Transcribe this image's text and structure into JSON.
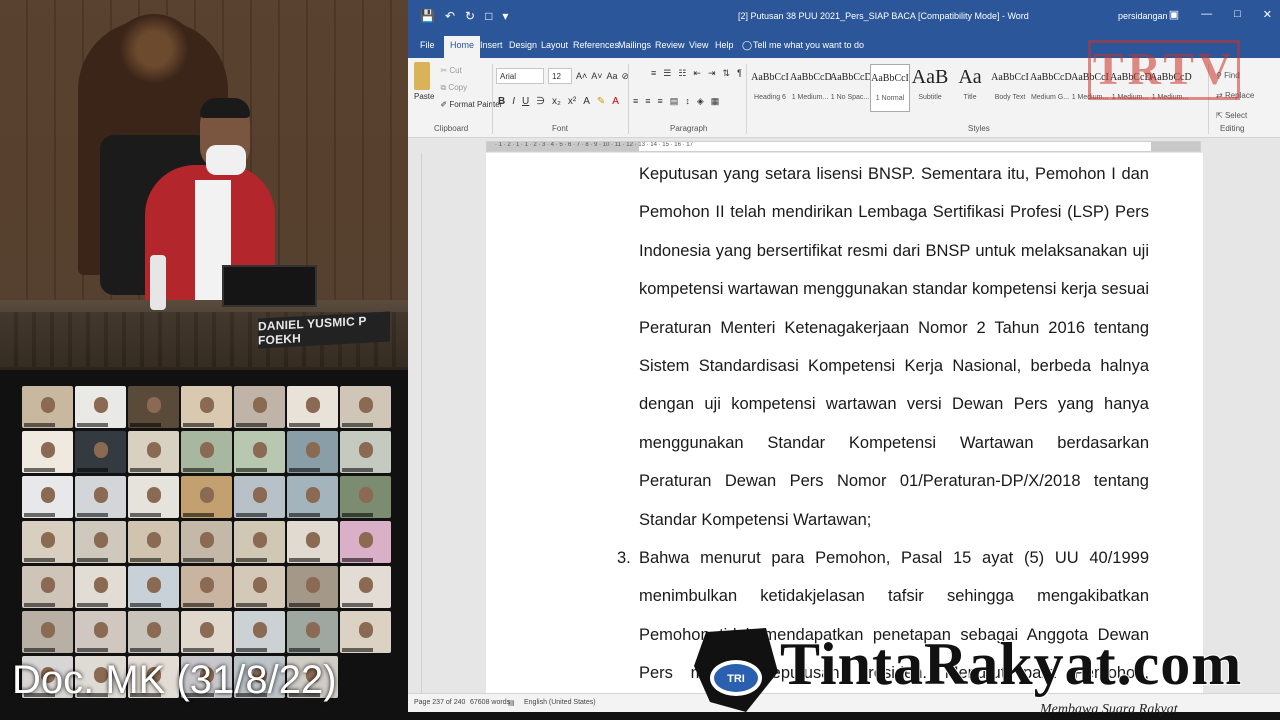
{
  "video": {
    "nameplate": "DANIEL YUSMIC P FOEKH",
    "doc_label": "Doc. MK (31/8/22)"
  },
  "gallery": {
    "tile_colors": [
      "#c9b8a0",
      "#e9e9e6",
      "#5a4a3a",
      "#d8c9b0",
      "#c0b3a8",
      "#e8e2d8",
      "#cfc6b8",
      "#efe9e0",
      "#333a40",
      "#d8d0c0",
      "#a8b8a0",
      "#b8c8b0",
      "#8a9ea8",
      "#c4cac0",
      "#e8e8ea",
      "#d2d6d8",
      "#e6e2dc",
      "#c2a070",
      "#b8c0c8",
      "#a4b4bc",
      "#7c8c70",
      "#d8cfc0",
      "#cfc8bc",
      "#d0c4b0",
      "#c4b8a8",
      "#d0c8b4",
      "#e0dad0",
      "#dab0c8",
      "#cfc4b8",
      "#e2ddd4",
      "#c8d0d8",
      "#c8b4a0",
      "#d4c8b8",
      "#a49888",
      "#e2dcd4",
      "#b8b0a4",
      "#d0c8c0",
      "#c8c4bc",
      "#e0d8cc",
      "#ccd2d4",
      "#9ea8a0",
      "#dcd2c4",
      "#d8d6d4",
      "#dedad4",
      "#e2dcd4",
      "#c8c8cc",
      "#bcc4c8",
      "#d0ccc6"
    ]
  },
  "word": {
    "window_title": "[2] Putusan 38 PUU 2021_Pers_SIAP BACA [Compatibility Mode] - Word",
    "user": "persidangan",
    "tabs": [
      "File",
      "Home",
      "Insert",
      "Design",
      "Layout",
      "References",
      "Mailings",
      "Review",
      "View",
      "Help",
      "Tell me what you want to do"
    ],
    "clipboard": {
      "paste": "Paste",
      "cut": "Cut",
      "copy": "Copy",
      "format_painter": "Format Painter",
      "group": "Clipboard"
    },
    "font": {
      "name": "Arial",
      "size": "12",
      "group": "Font"
    },
    "paragraph_group": "Paragraph",
    "styles_group": "Styles",
    "editing_group": "Editing",
    "editing": {
      "find": "Find",
      "replace": "Replace",
      "select": "Select"
    },
    "styles": [
      {
        "preview": "AaBbCcI",
        "name": "Heading 6"
      },
      {
        "preview": "AaBbCcD",
        "name": "1 Medium..."
      },
      {
        "preview": "AaBbCcD",
        "name": "1 No Spac..."
      },
      {
        "preview": "AaBbCcI",
        "name": "1 Normal"
      },
      {
        "preview": "AaB",
        "name": "Subtitle"
      },
      {
        "preview": "Aa",
        "name": "Title"
      },
      {
        "preview": "AaBbCcI",
        "name": "Body Text"
      },
      {
        "preview": "AaBbCcD",
        "name": "Medium G..."
      },
      {
        "preview": "AaBbCcI",
        "name": "1 Medium..."
      },
      {
        "preview": "AaBbCcD",
        "name": "1 Medium..."
      },
      {
        "preview": "AaBbCcD",
        "name": "1 Medium..."
      }
    ],
    "ruler_text": "· 1 · 2 · 1 · 1 · 2 · 3 · 4 · 5 · 6 · 7 · 8 · 9 · 10 · 11 · 12 · 13 · 14 · 15 · 16 · 17",
    "document": {
      "p1": "Keputusan yang setara lisensi BNSP. Sementara itu, Pemohon I dan Pemohon II telah mendirikan Lembaga Sertifikasi Profesi (LSP) Pers Indonesia yang bersertifikat resmi dari BNSP untuk melaksanakan uji kompetensi wartawan menggunakan standar kompetensi kerja sesuai Peraturan Menteri Ketenagakerjaan Nomor 2 Tahun 2016 tentang Sistem Standardisasi Kompetensi Kerja Nasional, berbeda halnya dengan uji kompetensi wartawan versi Dewan Pers yang hanya menggunakan Standar Kompetensi Wartawan berdasarkan Peraturan Dewan Pers Nomor 01/Peraturan-DP/X/2018 tentang Standar Kompetensi Wartawan;",
      "item3_number": "3.",
      "item3": "Bahwa menurut para Pemohon, Pasal 15 ayat (5) UU 40/1999 menimbulkan ketidakjelasan tafsir sehingga mengakibatkan Pemohon tidak mendapatkan penetapan sebagai Anggota Dewan Pers melalui Keputusan Presiden. Menurut para Pemohon, seharusnya Keputusan Presiden hanya bersifat administratif sesuai"
    },
    "status": {
      "page": "Page 237 of 240",
      "words": "67608 words",
      "language": "English (United States)"
    }
  },
  "watermark": {
    "top_right": "TRTV",
    "brand": "TintaRakyat.com",
    "logo_text": "TRI",
    "tagline": "Membawa Suara Rakyat"
  },
  "colors": {
    "word_blue": "#2b579a",
    "robe_red": "#b3262b"
  }
}
